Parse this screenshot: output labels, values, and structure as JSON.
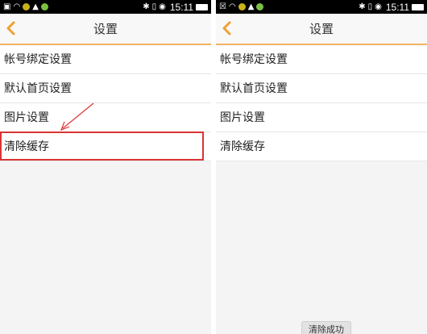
{
  "left": {
    "status": {
      "time": "15:11",
      "left_icons": [
        "sim-icon",
        "wifi-icon",
        "sync-icon",
        "image-icon",
        "chat-icon"
      ],
      "right_icons": [
        "bluetooth-icon",
        "vibrate-icon",
        "alarm-icon",
        "battery-icon"
      ]
    },
    "header": {
      "title": "设置"
    },
    "items": [
      {
        "label": "帐号绑定设置"
      },
      {
        "label": "默认首页设置"
      },
      {
        "label": "图片设置"
      },
      {
        "label": "清除缓存"
      }
    ],
    "highlight_color": "#d93434"
  },
  "right": {
    "status": {
      "time": "15:11",
      "left_icons": [
        "close-icon",
        "wifi-icon",
        "sync-icon",
        "image-icon",
        "chat-icon"
      ],
      "right_icons": [
        "bluetooth-icon",
        "vibrate-icon",
        "alarm-icon",
        "battery-icon"
      ]
    },
    "header": {
      "title": "设置"
    },
    "items": [
      {
        "label": "帐号绑定设置"
      },
      {
        "label": "默认首页设置"
      },
      {
        "label": "图片设置"
      },
      {
        "label": "清除缓存"
      }
    ],
    "toast": "清除成功"
  },
  "accent": "#f0a030"
}
